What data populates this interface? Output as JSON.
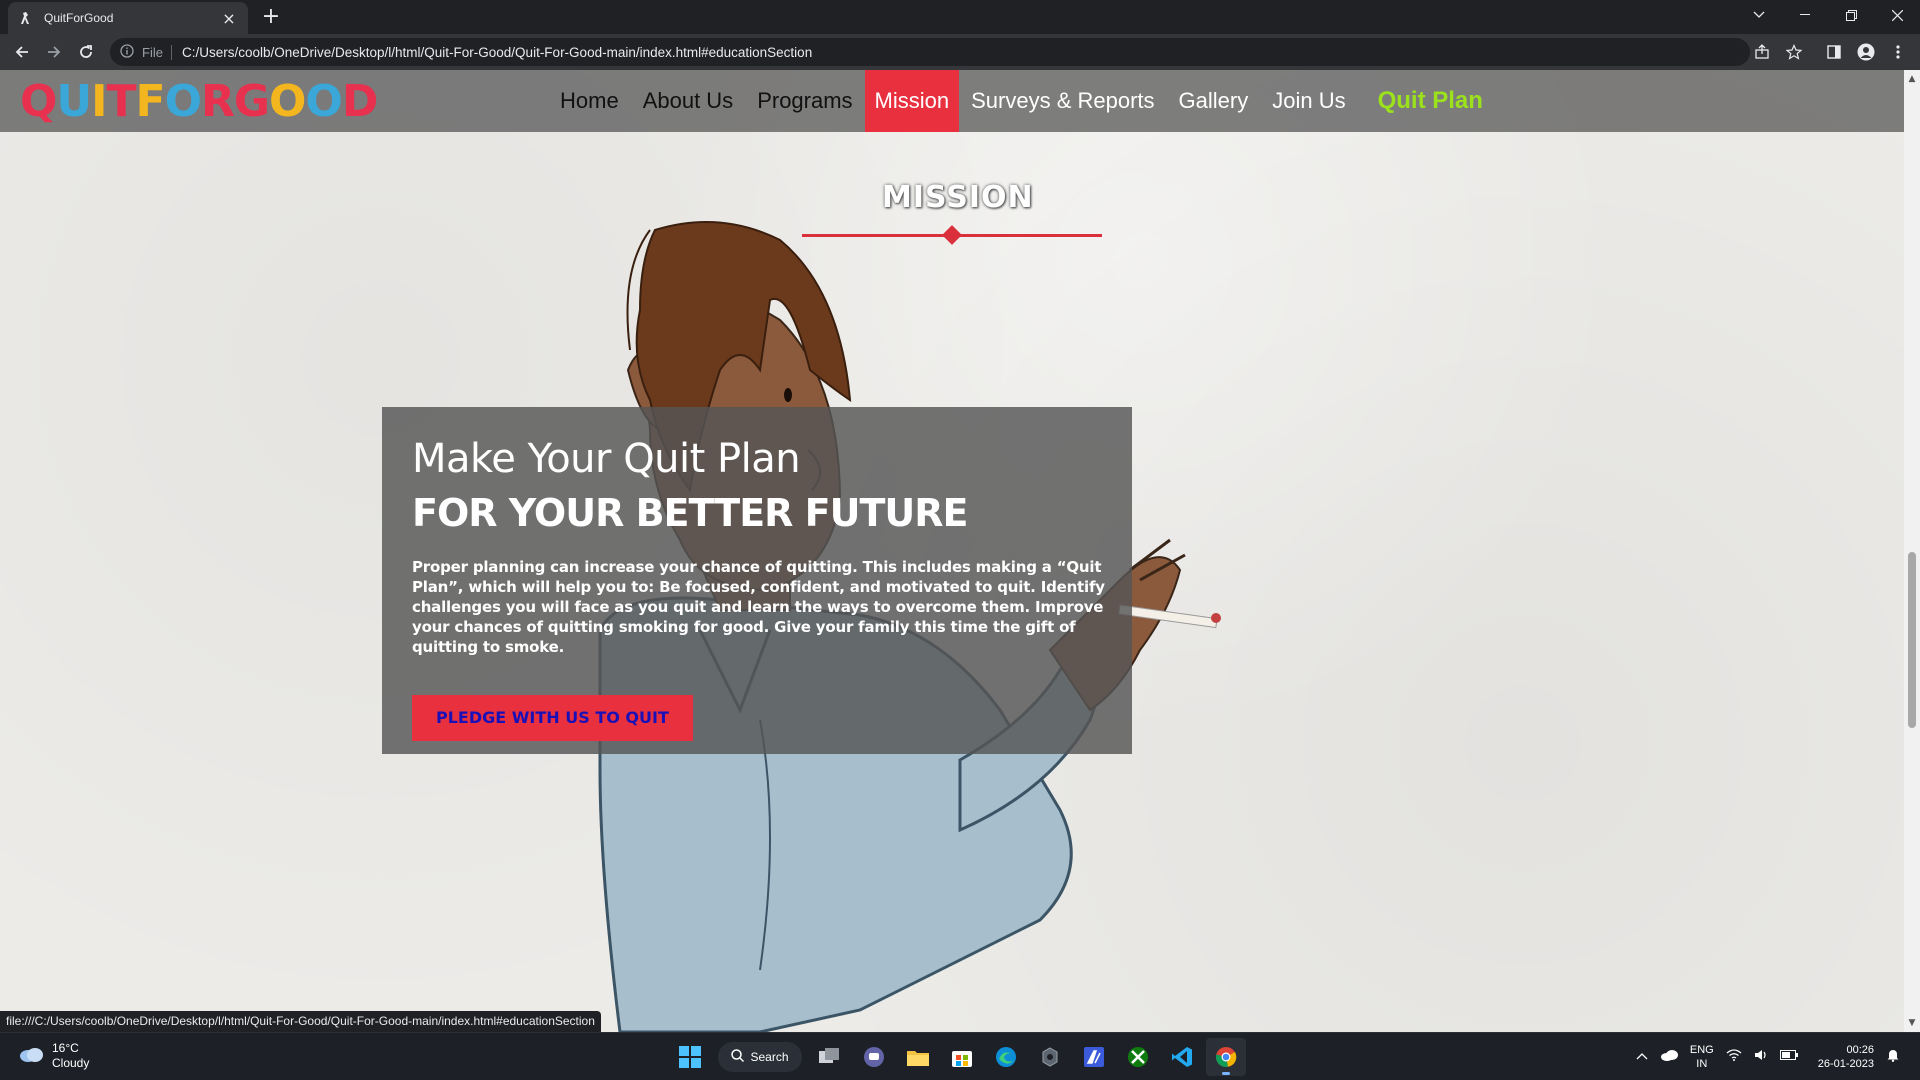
{
  "browser": {
    "tab_title": "QuitForGood",
    "new_tab_label": "+",
    "address_scheme_label": "File",
    "url": "C:/Users/coolb/OneDrive/Desktop/l/html/Quit-For-Good/Quit-For-Good-main/index.html#educationSection",
    "status_url": "file:///C:/Users/coolb/OneDrive/Desktop/l/html/Quit-For-Good/Quit-For-Good-main/index.html#educationSection"
  },
  "site": {
    "logo_letters": [
      "Q",
      "U",
      "I",
      "T",
      "F",
      "O",
      "R",
      "G",
      "O",
      "O",
      "D"
    ],
    "logo_colors": [
      "#e8304f",
      "#3aa7d8",
      "#f3b61f",
      "#e8304f",
      "#f3b61f",
      "#3aa7d8",
      "#e8304f",
      "#e8304f",
      "#f3b61f",
      "#3aa7d8",
      "#e8304f"
    ],
    "nav": {
      "home": "Home",
      "about": "About Us",
      "programs": "Programs",
      "mission": "Mission",
      "surveys": "Surveys & Reports",
      "gallery": "Gallery",
      "join": "Join Us",
      "quit_plan": "Quit Plan"
    },
    "accent_color": "#e8303f",
    "quit_plan_color": "#9be21d"
  },
  "section": {
    "title": "MISSION"
  },
  "card": {
    "heading": "Make Your Quit Plan",
    "subheading": "FOR YOUR BETTER FUTURE",
    "body": "Proper planning can increase your chance of quitting. This includes making a “Quit Plan”, which will help you to: Be focused, confident, and motivated to quit. Identify challenges you will face as you quit and learn the ways to overcome them. Improve your chances of quitting smoking for good. Give your family this time the gift of quitting to smoke.",
    "button": "PLEDGE WITH US TO QUIT"
  },
  "taskbar": {
    "temperature": "16°C",
    "weather": "Cloudy",
    "search_label": "Search",
    "lang_top": "ENG",
    "lang_bottom": "IN",
    "time": "00:26",
    "date": "26-01-2023"
  }
}
